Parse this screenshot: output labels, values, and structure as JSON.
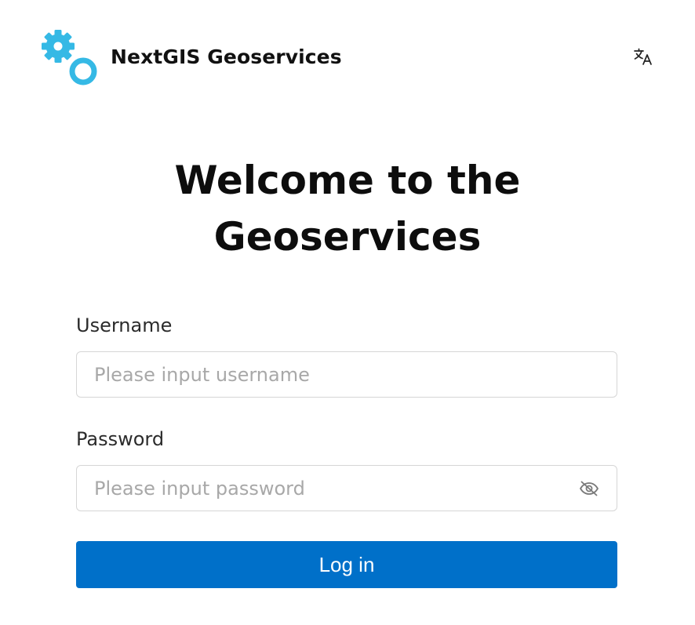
{
  "header": {
    "logo_icon": "gears-icon",
    "brand_name": "NextGIS Geoservices",
    "language_icon": "translate-icon",
    "accent_color": "#35b9e5"
  },
  "main": {
    "title_line1": "Welcome to the",
    "title_line2": "Geoservices"
  },
  "form": {
    "username_label": "Username",
    "username_placeholder": "Please input username",
    "username_value": "",
    "password_label": "Password",
    "password_placeholder": "Please input password",
    "password_value": "",
    "password_visibility_icon": "eye-off-icon",
    "login_label": "Log in",
    "login_color": "#0070c9"
  }
}
